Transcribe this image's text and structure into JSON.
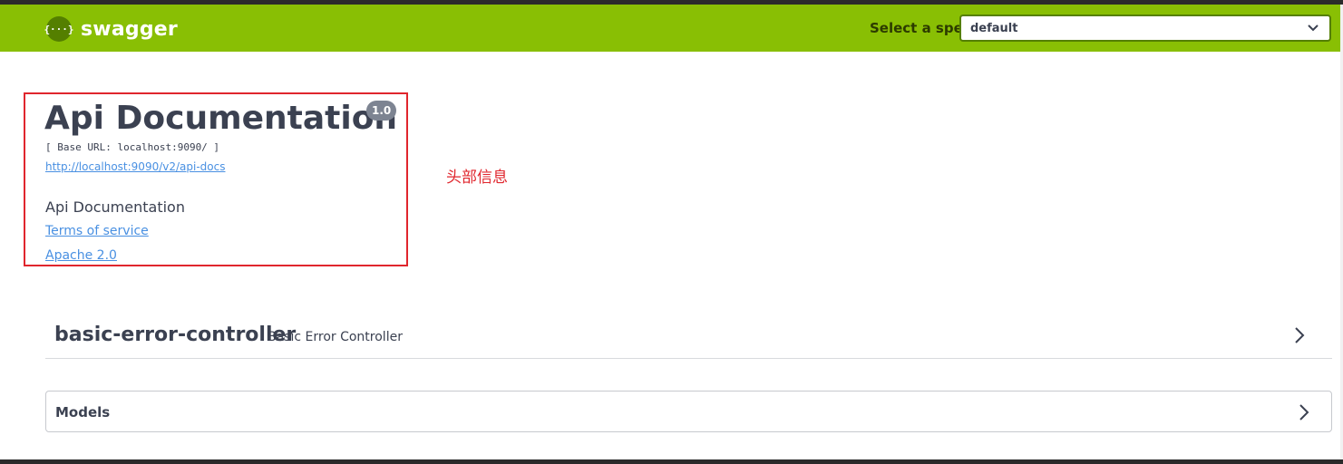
{
  "topbar": {
    "logo_mark": "{···}",
    "logo_text": "swagger",
    "spec_label": "Select a spec",
    "spec_selected": "default"
  },
  "info": {
    "title": "Api Documentation",
    "version": "1.0",
    "base_url": "[ Base URL: localhost:9090/ ]",
    "api_docs_link": "http://localhost:9090/v2/api-docs",
    "description": "Api Documentation",
    "terms_link": "Terms of service",
    "license_link": "Apache 2.0"
  },
  "annotation": {
    "text": "头部信息",
    "color": "#e0262d"
  },
  "tags": [
    {
      "name": "basic-error-controller",
      "description": "Basic Error Controller"
    }
  ],
  "models": {
    "label": "Models"
  },
  "colors": {
    "topbar": "#89bf04",
    "link": "#4990e2",
    "text": "#3b4151",
    "badge": "#7d8492"
  },
  "icons": {
    "logo": "swagger-logo-icon",
    "spec_dropdown": "chevron-down-icon",
    "tag_expand": "chevron-right-icon",
    "models_expand": "chevron-right-icon"
  }
}
